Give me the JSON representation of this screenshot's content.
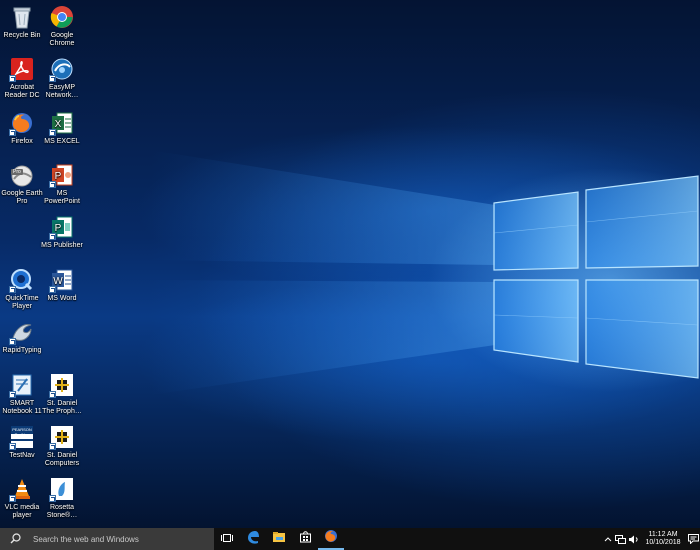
{
  "desktop": {
    "icons": [
      {
        "label": "Recycle Bin",
        "icon": "recycle-bin-icon",
        "shortcut": false
      },
      {
        "label": "Google\nChrome",
        "icon": "chrome-icon",
        "shortcut": false
      },
      {
        "label": "Acrobat\nReader DC",
        "icon": "acrobat-icon",
        "shortcut": true
      },
      {
        "label": "EasyMP\nNetwork…",
        "icon": "easymp-icon",
        "shortcut": true
      },
      {
        "label": "Firefox",
        "icon": "firefox-icon",
        "shortcut": true
      },
      {
        "label": "MS EXCEL",
        "icon": "excel-icon",
        "shortcut": true
      },
      {
        "label": "Google Earth\nPro",
        "icon": "google-earth-icon",
        "shortcut": false,
        "badge": "Pro"
      },
      {
        "label": "MS\nPowerPoint",
        "icon": "powerpoint-icon",
        "shortcut": true
      },
      {
        "label": "MS Publisher",
        "icon": "publisher-icon",
        "shortcut": true
      },
      {
        "label": "QuickTime\nPlayer",
        "icon": "quicktime-icon",
        "shortcut": true
      },
      {
        "label": "MS Word",
        "icon": "word-icon",
        "shortcut": true
      },
      {
        "label": "RapidTyping",
        "icon": "rapidtyping-icon",
        "shortcut": true
      },
      {
        "label": "SMART\nNotebook 11",
        "icon": "smart-notebook-icon",
        "shortcut": true
      },
      {
        "label": "St. Daniel\nThe Proph…",
        "icon": "st-daniel-icon",
        "shortcut": true
      },
      {
        "label": "TestNav",
        "icon": "testnav-icon",
        "shortcut": true,
        "badge": "PEARSON\nTestNav"
      },
      {
        "label": "St. Daniel\nComputers",
        "icon": "st-daniel-icon",
        "shortcut": true
      },
      {
        "label": "VLC media\nplayer",
        "icon": "vlc-icon",
        "shortcut": true
      },
      {
        "label": "Rosetta\nStone®…",
        "icon": "rosetta-stone-icon",
        "shortcut": true
      }
    ]
  },
  "taskbar": {
    "search_placeholder": "Search the web and Windows",
    "pinned": [
      {
        "name": "task-view-icon"
      },
      {
        "name": "edge-icon"
      },
      {
        "name": "file-explorer-icon"
      },
      {
        "name": "store-icon"
      },
      {
        "name": "firefox-icon"
      }
    ],
    "tray": {
      "icons": [
        "chevron-up-icon",
        "network-icon",
        "volume-icon",
        "action-center-icon"
      ],
      "time": "11:12 AM",
      "date": "10/10/2018"
    }
  },
  "colors": {
    "taskbar": "#101010",
    "search_box": "#3a3a3a",
    "accent": "#76b9ed"
  }
}
